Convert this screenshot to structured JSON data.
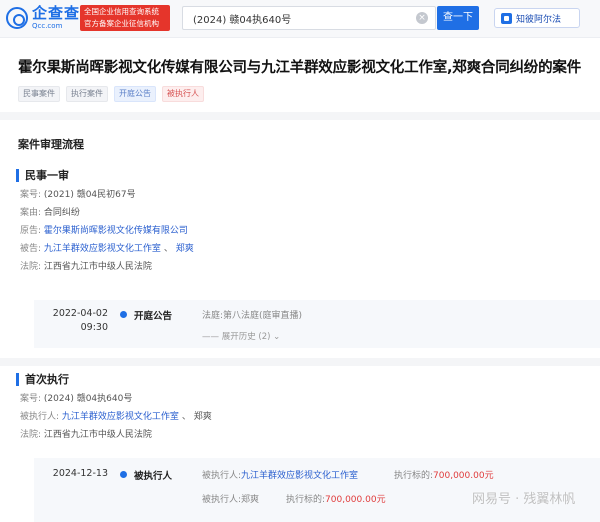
{
  "header": {
    "logo_name": "企查查",
    "logo_sub": "Qcc.com",
    "badge_line1": "全国企业信用查询系统",
    "badge_line2": "官方备案企业征信机构",
    "search_value": "(2024) 赣04执640号",
    "search_button": "查一下",
    "zhiyun_label": "知彼阿尔法"
  },
  "case": {
    "title": "霍尔果斯尚晖影视文化传媒有限公司与九江羊群效应影视文化工作室,郑爽合同纠纷的案件",
    "tags": [
      {
        "label": "民事案件",
        "style": "gray"
      },
      {
        "label": "执行案件",
        "style": "gray"
      },
      {
        "label": "开庭公告",
        "style": "blue"
      },
      {
        "label": "被执行人",
        "style": "red"
      }
    ]
  },
  "section_title": "案件审理流程",
  "stage1": {
    "name": "民事一审",
    "case_no_label": "案号:",
    "case_no": "(2021) 赣04民初67号",
    "cause_label": "案由:",
    "cause": "合同纠纷",
    "plaintiff_label": "原告:",
    "plaintiff": "霍尔果斯尚晖影视文化传媒有限公司",
    "defendant_label": "被告:",
    "defendant": "九江羊群效应影视文化工作室",
    "defendant_sep": "、",
    "defendant2": "郑爽",
    "court_label": "法院:",
    "court": "江西省九江市中级人民法院",
    "event": {
      "date": "2022-04-02",
      "time": "09:30",
      "label": "开庭公告",
      "detail_label": "法庭:",
      "detail": "第八法庭(庭审直播)",
      "expand": "展开历史 (2)"
    }
  },
  "stage2": {
    "name": "首次执行",
    "case_no_label": "案号:",
    "case_no": "(2024) 赣04执640号",
    "executed_label": "被执行人:",
    "executed": "九江羊群效应影视文化工作室",
    "executed_sep": "、",
    "executed2": "郑爽",
    "court_label": "法院:",
    "court": "江西省九江市中级人民法院",
    "event": {
      "date": "2024-12-13",
      "label": "被执行人",
      "row1_label": "被执行人:",
      "row1_value": "九江羊群效应影视文化工作室",
      "row1_amount_label": "执行标的:",
      "row1_amount": "700,000.00元",
      "row2_label": "被执行人:",
      "row2_value": "郑爽",
      "row2_amount_label": "执行标的:",
      "row2_amount": "700,000.00元"
    }
  },
  "watermark": "网易号 · 残翼林帆"
}
